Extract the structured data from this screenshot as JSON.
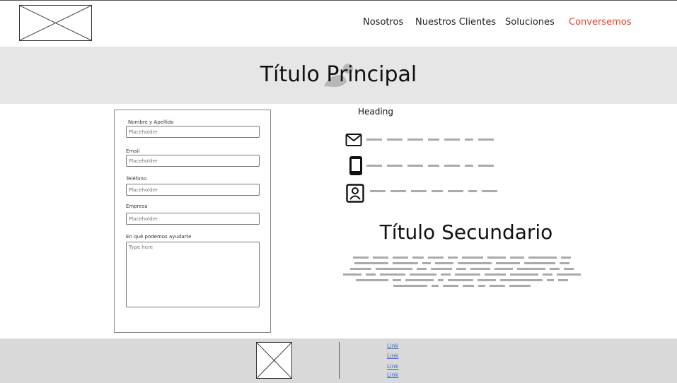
{
  "header": {
    "nav": [
      {
        "label": "Nosotros"
      },
      {
        "label": "Nuestros Clientes"
      },
      {
        "label": "Soluciones"
      },
      {
        "label": "Conversemos"
      }
    ],
    "accent_color": "#e8432e"
  },
  "hero": {
    "title": "Título Principal"
  },
  "form": {
    "fields": [
      {
        "label": "Nombre y Apellido",
        "placeholder": "Placeholder"
      },
      {
        "label": "Email",
        "placeholder": "Placeholder"
      },
      {
        "label": "Teléfono",
        "placeholder": "Placeholder"
      },
      {
        "label": "Empresa",
        "placeholder": "Placeholder"
      }
    ],
    "message": {
      "label": "En qué podemos ayudarte",
      "placeholder": "Type here"
    }
  },
  "contact": {
    "heading": "Heading",
    "items": [
      {
        "icon": "mail-icon"
      },
      {
        "icon": "phone-icon"
      },
      {
        "icon": "contact-card-icon"
      }
    ]
  },
  "secondary": {
    "title": "Título Secundario"
  },
  "footer": {
    "links": [
      "Link",
      "Link",
      "Link",
      "Link"
    ]
  }
}
